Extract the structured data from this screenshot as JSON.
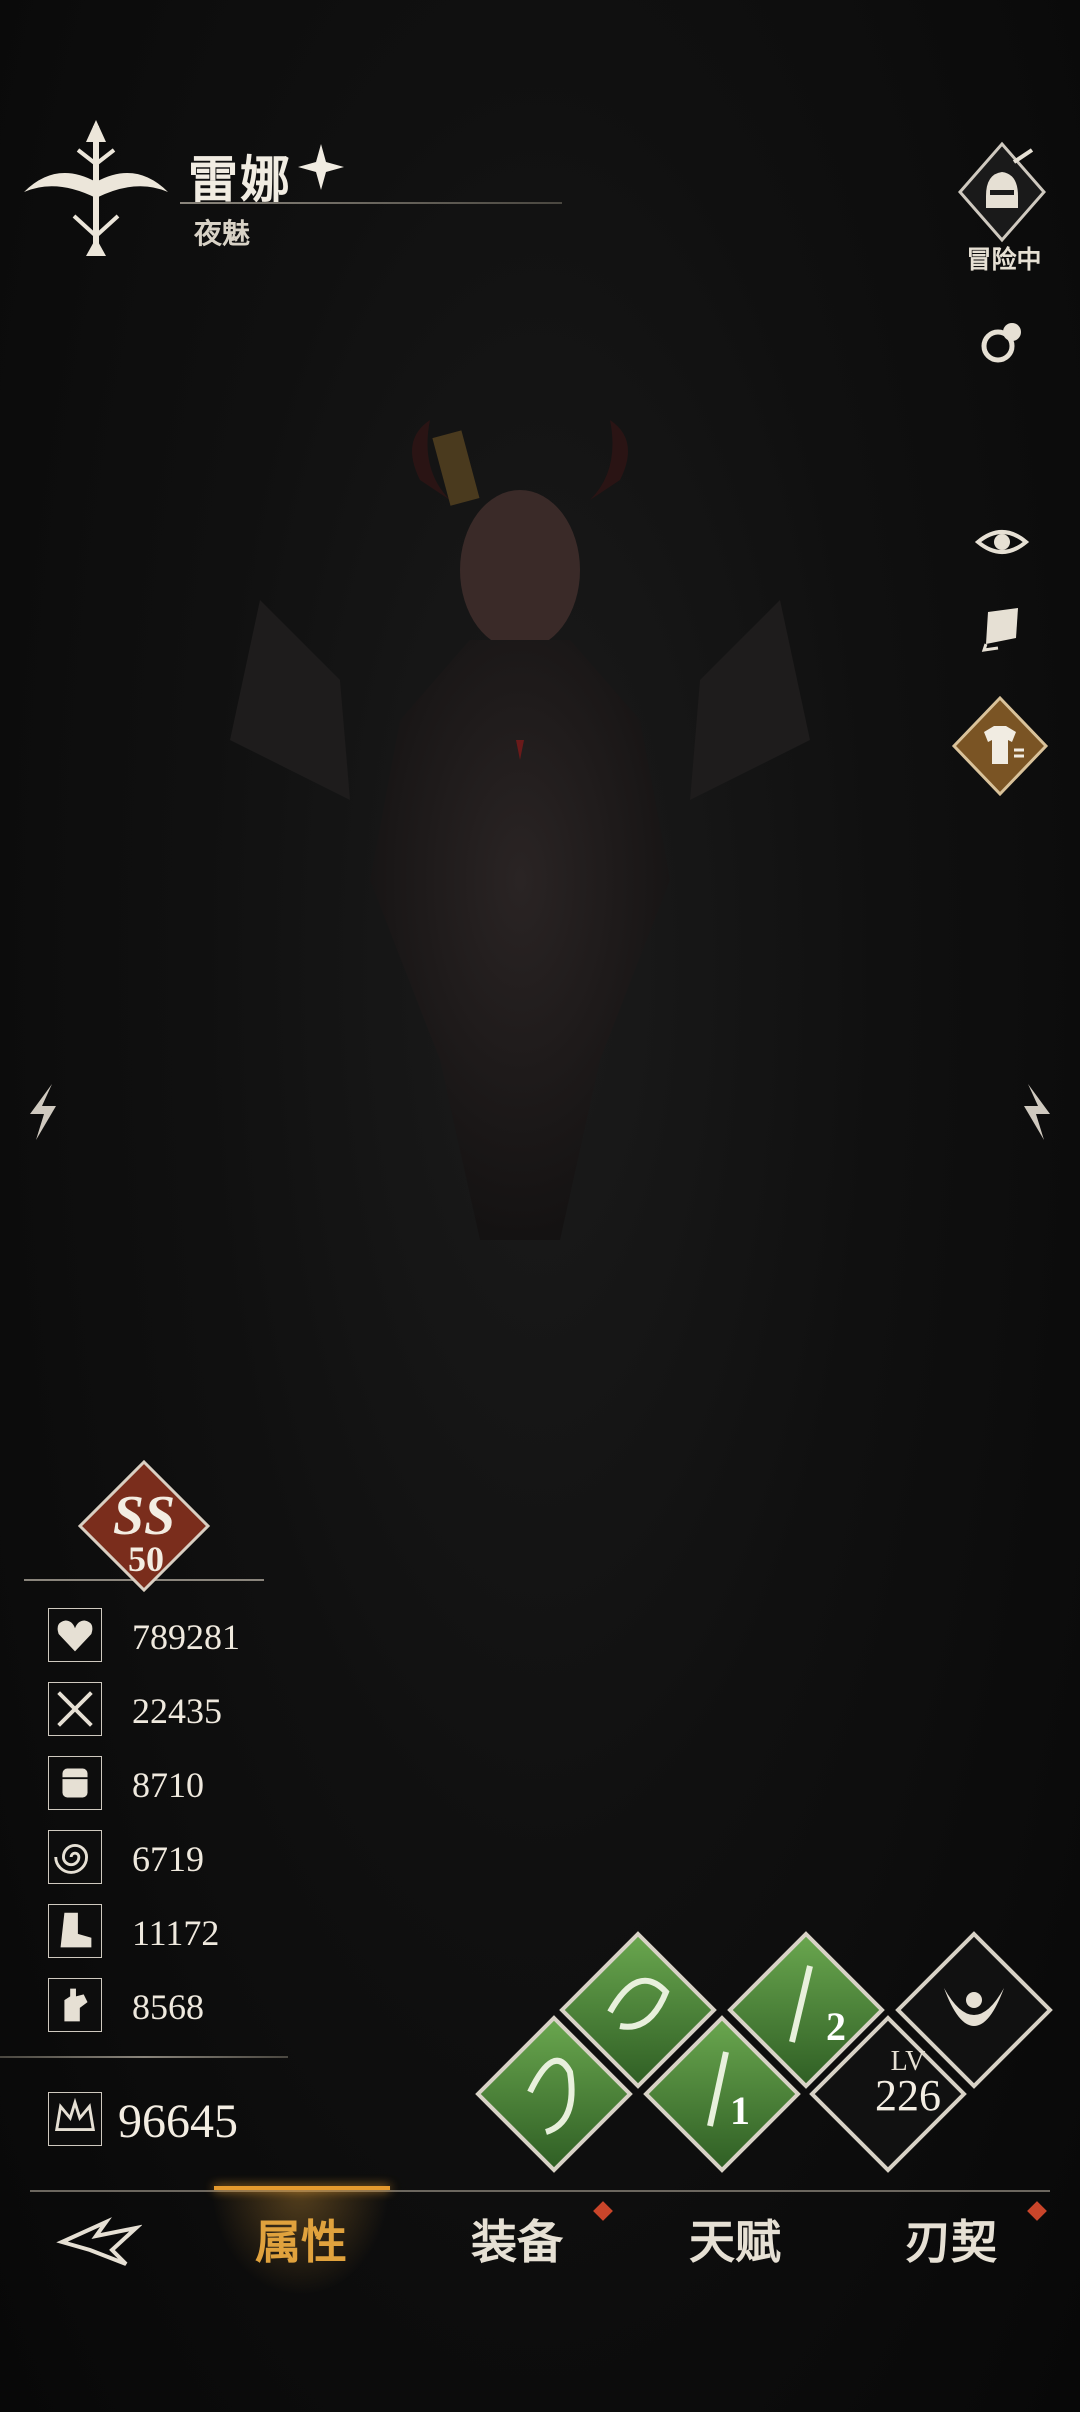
{
  "header": {
    "name": "雷娜",
    "title": "夜魅"
  },
  "side": {
    "adventure_label": "冒险中"
  },
  "grade": {
    "rank": "SS",
    "level": "50"
  },
  "stats": [
    {
      "icon": "heart-icon",
      "value": "789281"
    },
    {
      "icon": "crossed-swords-icon",
      "value": "22435"
    },
    {
      "icon": "fist-icon",
      "value": "8710"
    },
    {
      "icon": "swirl-icon",
      "value": "6719"
    },
    {
      "icon": "boot-icon",
      "value": "11172"
    },
    {
      "icon": "hand-icon",
      "value": "8568"
    }
  ],
  "power": {
    "icon": "crown-icon",
    "value": "96645"
  },
  "skills": {
    "level_label": "LV",
    "level_value": "226",
    "slot_numbers": [
      "2",
      "1"
    ]
  },
  "nav": {
    "tabs": [
      "属性",
      "装备",
      "天赋",
      "刃契"
    ],
    "active": "属性"
  },
  "colors": {
    "accent": "#e0a23d",
    "badge": "#7a2d1c",
    "skill_green": "#4f8f3a",
    "notify_red": "#c9452a"
  }
}
